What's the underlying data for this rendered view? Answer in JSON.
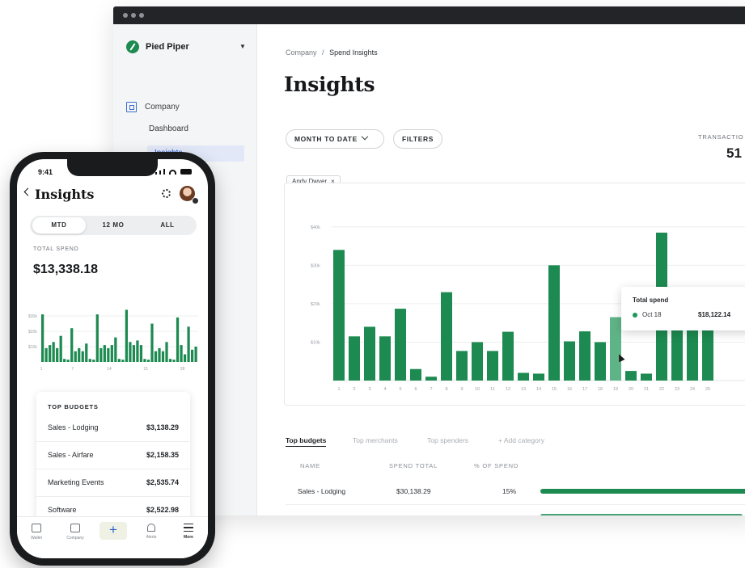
{
  "desktop": {
    "org_name": "Pied Piper",
    "sidebar": {
      "section": "Company",
      "items": [
        {
          "label": "Dashboard"
        },
        {
          "label": "Insights"
        }
      ]
    },
    "breadcrumb": {
      "parent": "Company",
      "separator": "/",
      "current": "Spend Insights"
    },
    "title": "Insights",
    "filters": {
      "date_range": "MONTH TO DATE",
      "filters_label": "FILTERS",
      "chip": "Andy Dwyer",
      "chip_close": "×"
    },
    "transactions": {
      "label": "TRANSACTIO",
      "value": "51"
    },
    "tooltip": {
      "title": "Total spend",
      "date": "Oct 18",
      "value": "$18,122.14"
    },
    "tabs": [
      "Top budgets",
      "Top merchants",
      "Top spenders",
      "+ Add category"
    ],
    "table": {
      "headers": [
        "NAME",
        "SPEND TOTAL",
        "% OF SPEND"
      ],
      "rows": [
        {
          "name": "Sales - Lodging",
          "spend_total": "$30,138.29",
          "percent": "15%",
          "fraction": 0.15
        }
      ]
    }
  },
  "chart_data": [
    {
      "type": "bar",
      "ytick_labels": [
        "$10k",
        "$20k",
        "$30k",
        "$40k"
      ],
      "ylim": [
        0,
        45000
      ],
      "grid": true,
      "categories": [
        "1",
        "2",
        "3",
        "4",
        "5",
        "6",
        "7",
        "8",
        "9",
        "10",
        "11",
        "12",
        "13",
        "14",
        "15",
        "16",
        "17",
        "18",
        "19",
        "20",
        "21",
        "22",
        "23",
        "24",
        "25"
      ],
      "values": [
        34000,
        11500,
        14000,
        11500,
        18700,
        3000,
        1000,
        23000,
        7700,
        10000,
        7700,
        12700,
        2000,
        1800,
        30000,
        10200,
        12800,
        10000,
        16500,
        2500,
        1800,
        38500,
        17000,
        17000,
        17000
      ],
      "highlight_index": 18
    },
    {
      "type": "bar",
      "ytick_labels": [
        "$10k",
        "$20k",
        "$30k"
      ],
      "ylim": [
        0,
        40000
      ],
      "grid": true,
      "xtick_labels": [
        "1",
        "7",
        "14",
        "21",
        "28"
      ],
      "values": [
        31000,
        9000,
        11000,
        13000,
        9000,
        17000,
        2000,
        1500,
        22000,
        7000,
        9000,
        7000,
        12000,
        2000,
        1500,
        31000,
        9000,
        11000,
        9000,
        11000,
        16000,
        2000,
        1500,
        34000,
        13000,
        11000,
        14000,
        11000,
        2000,
        1500,
        25000,
        7000,
        9000,
        7000,
        13000,
        2000,
        1500,
        29000,
        11000,
        5000,
        23000,
        8000,
        10000
      ]
    }
  ],
  "mobile": {
    "time": "9:41",
    "title": "Insights",
    "segments": [
      "MTD",
      "12 MO",
      "ALL"
    ],
    "total_label": "TOTAL SPEND",
    "total_value": "$13,338.18",
    "budgets_title": "TOP BUDGETS",
    "budgets": [
      {
        "name": "Sales - Lodging",
        "amount": "$3,138.29"
      },
      {
        "name": "Sales - Airfare",
        "amount": "$2,158.35"
      },
      {
        "name": "Marketing Events",
        "amount": "$2,535.74"
      },
      {
        "name": "Software",
        "amount": "$2,522.98"
      }
    ],
    "nav": [
      "Wallet",
      "Company",
      "+",
      "Alerts",
      "More"
    ]
  },
  "colors": {
    "bar": "#1d8a51",
    "bar_highlight": "#5fb487",
    "accent_blue": "#2c58c6"
  }
}
